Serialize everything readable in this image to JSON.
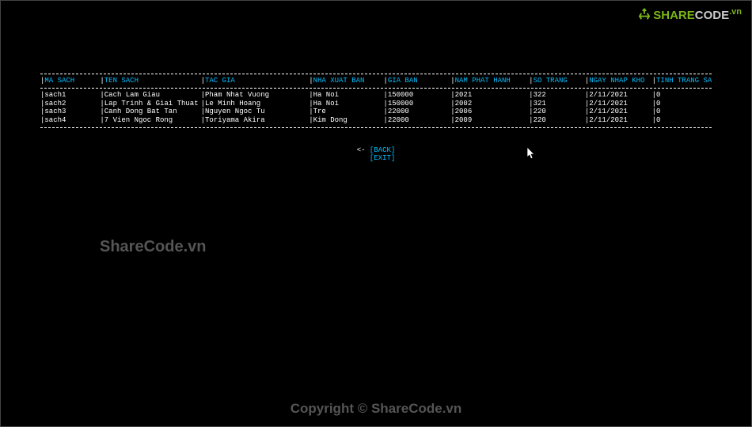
{
  "logo": {
    "share": "SHARE",
    "code": "CODE",
    "vn": ".vn"
  },
  "table": {
    "headers": {
      "ma_sach": "MA SACH",
      "ten_sach": "TEN SACH",
      "tac_gia": "TAC GIA",
      "nha_xuat_ban": "NHA XUAT BAN",
      "gia_ban": "GIA BAN",
      "nam_phat_hanh": "NAM PHAT HANH",
      "so_trang": "SO TRANG",
      "ngay_nhap_kho": "NGAY NHAP KHO",
      "tinh_trang_sach": "TINH TRANG SACH"
    },
    "rows": [
      {
        "ma_sach": "sach1",
        "ten_sach": "Cach Lam Giau",
        "tac_gia": "Pham Nhat Vuong",
        "nha_xuat_ban": "Ha Noi",
        "gia_ban": "150000",
        "nam_phat_hanh": "2021",
        "so_trang": "322",
        "ngay_nhap_kho": "2/11/2021",
        "tinh_trang_sach": "0"
      },
      {
        "ma_sach": "sach2",
        "ten_sach": "Lap Trinh & Giai Thuat",
        "tac_gia": "Le Minh Hoang",
        "nha_xuat_ban": "Ha Noi",
        "gia_ban": "150000",
        "nam_phat_hanh": "2002",
        "so_trang": "321",
        "ngay_nhap_kho": "2/11/2021",
        "tinh_trang_sach": "0"
      },
      {
        "ma_sach": "sach3",
        "ten_sach": "Canh Dong Bat Tan",
        "tac_gia": "Nguyen Ngoc Tu",
        "nha_xuat_ban": "Tre",
        "gia_ban": "22000",
        "nam_phat_hanh": "2006",
        "so_trang": "220",
        "ngay_nhap_kho": "2/11/2021",
        "tinh_trang_sach": "0"
      },
      {
        "ma_sach": "sach4",
        "ten_sach": "7 Vien Ngoc Rong",
        "tac_gia": "Toriyama Akira",
        "nha_xuat_ban": "Kim Dong",
        "gia_ban": "22000",
        "nam_phat_hanh": "2009",
        "so_trang": "220",
        "ngay_nhap_kho": "2/11/2021",
        "tinh_trang_sach": "0"
      }
    ]
  },
  "menu": {
    "back": "[BACK]",
    "exit": "[EXIT]",
    "arrow": "<- "
  },
  "watermark": {
    "mid": "ShareCode.vn",
    "copyright": "Copyright © ShareCode.vn"
  }
}
